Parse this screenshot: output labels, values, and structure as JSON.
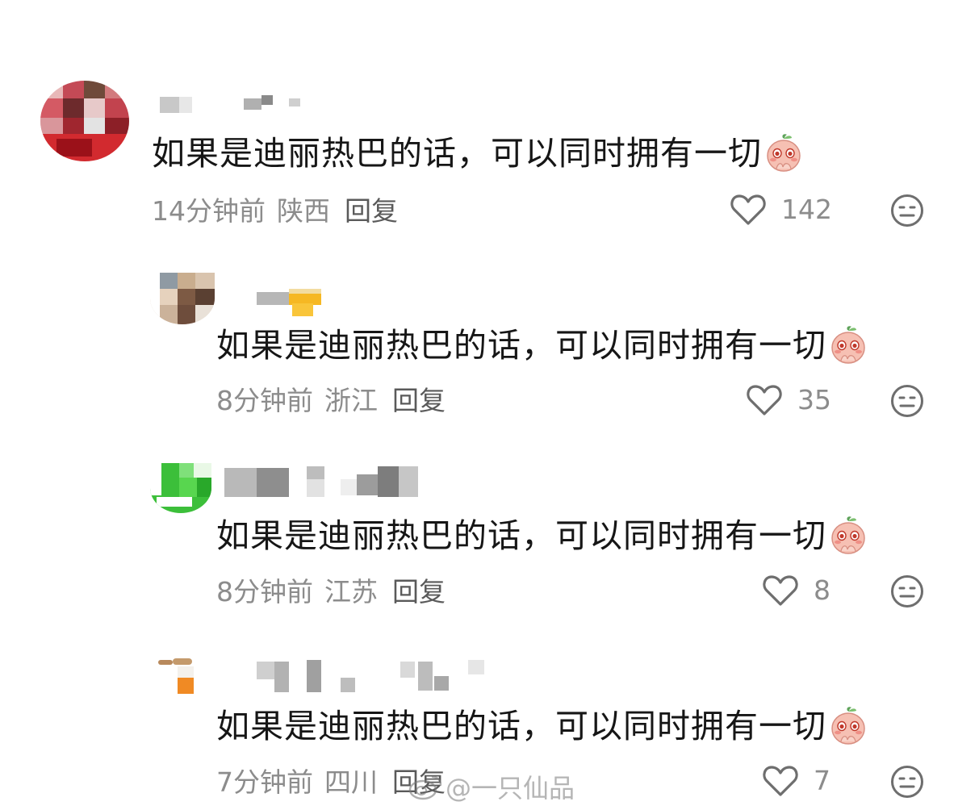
{
  "comments": [
    {
      "text": "如果是迪丽热巴的话，可以同时拥有一切",
      "time": "14分钟前",
      "location": "陕西",
      "reply_label": "回复",
      "likes": "142",
      "emoji_icon": "peach-shy-emoji-icon"
    },
    {
      "text": "如果是迪丽热巴的话，可以同时拥有一切",
      "time": "8分钟前",
      "location": "浙江",
      "reply_label": "回复",
      "likes": "35",
      "emoji_icon": "peach-shy-emoji-icon"
    },
    {
      "text": "如果是迪丽热巴的话，可以同时拥有一切",
      "time": "8分钟前",
      "location": "江苏",
      "reply_label": "回复",
      "likes": "8",
      "emoji_icon": "peach-shy-emoji-icon"
    },
    {
      "text": "如果是迪丽热巴的话，可以同时拥有一切",
      "time": "7分钟前",
      "location": "四川",
      "reply_label": "回复",
      "likes": "7",
      "emoji_icon": "peach-shy-emoji-icon"
    }
  ],
  "watermark": {
    "text": "@一只仙品",
    "icon": "weibo-logo-icon"
  },
  "colors": {
    "text": "#161616",
    "meta": "#8c8c8c",
    "icon": "#6e6e6e",
    "peach": "#f4b3a8"
  }
}
